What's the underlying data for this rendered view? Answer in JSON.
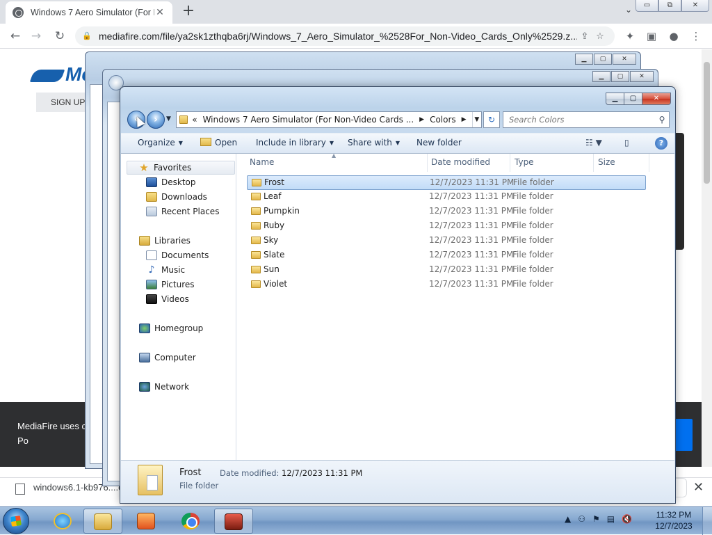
{
  "browser": {
    "tab_title": "Windows 7 Aero Simulator (For N",
    "tab_close": "✕",
    "new_tab": "+",
    "url": "mediafire.com/file/ya2sk1zthqba6rj/Windows_7_Aero_Simulator_%2528For_Non-Video_Cards_Only%2529.z...",
    "window_buttons": [
      "▭",
      "⧉",
      "✕"
    ]
  },
  "mediafire": {
    "logo_text": "Me",
    "signup_label": "SIGN UP",
    "cookie_text": "MediaFire uses c to our Privacy Po"
  },
  "download_shelf": {
    "file_name": "windows6.1-kb976....e",
    "close": "✕"
  },
  "explorer": {
    "breadcrumbs": [
      "«",
      "Windows 7 Aero Simulator (For Non-Video Cards ...",
      "Colors"
    ],
    "search_placeholder": "Search Colors",
    "toolbar": {
      "organize": "Organize",
      "open": "Open",
      "include_in_library": "Include in library",
      "share_with": "Share with",
      "new_folder": "New folder"
    },
    "nav": {
      "favorites": "Favorites",
      "desktop": "Desktop",
      "downloads": "Downloads",
      "recent_places": "Recent Places",
      "libraries": "Libraries",
      "documents": "Documents",
      "music": "Music",
      "pictures": "Pictures",
      "videos": "Videos",
      "homegroup": "Homegroup",
      "computer": "Computer",
      "network": "Network"
    },
    "columns": [
      "Name",
      "Date modified",
      "Type",
      "Size"
    ],
    "files": [
      {
        "name": "Frost",
        "date": "12/7/2023 11:31 PM",
        "type": "File folder"
      },
      {
        "name": "Leaf",
        "date": "12/7/2023 11:31 PM",
        "type": "File folder"
      },
      {
        "name": "Pumpkin",
        "date": "12/7/2023 11:31 PM",
        "type": "File folder"
      },
      {
        "name": "Ruby",
        "date": "12/7/2023 11:31 PM",
        "type": "File folder"
      },
      {
        "name": "Sky",
        "date": "12/7/2023 11:31 PM",
        "type": "File folder"
      },
      {
        "name": "Slate",
        "date": "12/7/2023 11:31 PM",
        "type": "File folder"
      },
      {
        "name": "Sun",
        "date": "12/7/2023 11:31 PM",
        "type": "File folder"
      },
      {
        "name": "Violet",
        "date": "12/7/2023 11:31 PM",
        "type": "File folder"
      }
    ],
    "details": {
      "name": "Frost",
      "type": "File folder",
      "modified_label": "Date modified:",
      "modified_value": "12/7/2023 11:31 PM"
    }
  },
  "taskbar": {
    "time": "11:32 PM",
    "date": "12/7/2023"
  }
}
